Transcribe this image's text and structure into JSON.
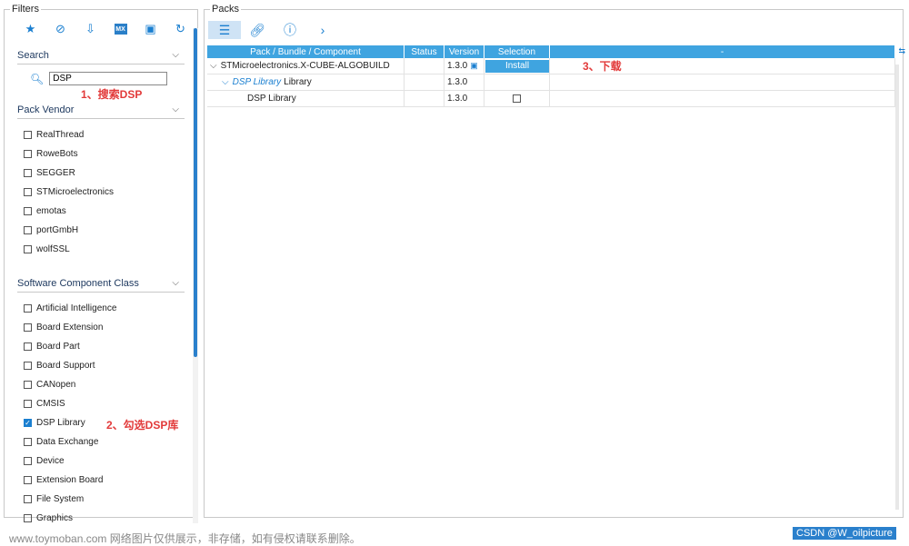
{
  "filters": {
    "title": "Filters",
    "search_label": "Search",
    "search_value": "DSP",
    "pack_vendor_label": "Pack Vendor",
    "vendors": [
      {
        "label": "RealThread",
        "checked": false
      },
      {
        "label": "RoweBots",
        "checked": false
      },
      {
        "label": "SEGGER",
        "checked": false
      },
      {
        "label": "STMicroelectronics",
        "checked": false
      },
      {
        "label": "emotas",
        "checked": false
      },
      {
        "label": "portGmbH",
        "checked": false
      },
      {
        "label": "wolfSSL",
        "checked": false
      }
    ],
    "component_class_label": "Software Component Class",
    "classes": [
      {
        "label": "Artificial Intelligence",
        "checked": false
      },
      {
        "label": "Board Extension",
        "checked": false
      },
      {
        "label": "Board Part",
        "checked": false
      },
      {
        "label": "Board Support",
        "checked": false
      },
      {
        "label": "CANopen",
        "checked": false
      },
      {
        "label": "CMSIS",
        "checked": false
      },
      {
        "label": "DSP Library",
        "checked": true
      },
      {
        "label": "Data Exchange",
        "checked": false
      },
      {
        "label": "Device",
        "checked": false
      },
      {
        "label": "Extension Board",
        "checked": false
      },
      {
        "label": "File System",
        "checked": false
      },
      {
        "label": "Graphics",
        "checked": false
      }
    ],
    "toolbar_icons": [
      "star-icon",
      "check-circle-icon",
      "install-icon",
      "mx-icon",
      "chip-icon",
      "refresh-icon"
    ],
    "mx_label": "MX"
  },
  "annotations": {
    "step1": "1、搜索DSP",
    "step2": "2、勾选DSP库",
    "step3": "3、下载"
  },
  "packs": {
    "title": "Packs",
    "toolbar_icons": [
      "list-settings-icon",
      "link-icon",
      "info-icon",
      "chevron-right-icon"
    ],
    "columns": [
      "Pack / Bundle / Component",
      "Status",
      "Version",
      "Selection",
      "-"
    ],
    "rows": [
      {
        "name": "STMicroelectronics.X-CUBE-ALGOBUILD",
        "status": "",
        "version": "1.3.0",
        "selection": "Install"
      },
      {
        "name_italic": "DSP Library",
        "name_suffix": "Library",
        "status": "",
        "version": "1.3.0",
        "selection": ""
      },
      {
        "name": "DSP Library",
        "status": "",
        "version": "1.3.0",
        "selection": ""
      }
    ]
  },
  "footer": {
    "watermark": "www.toymoban.com 网络图片仅供展示，非存储，如有侵权请联系删除。",
    "csdn": "CSDN @W_oilpicture"
  },
  "colors": {
    "accent": "#3fa4e0",
    "annotation": "#e23a3a"
  }
}
